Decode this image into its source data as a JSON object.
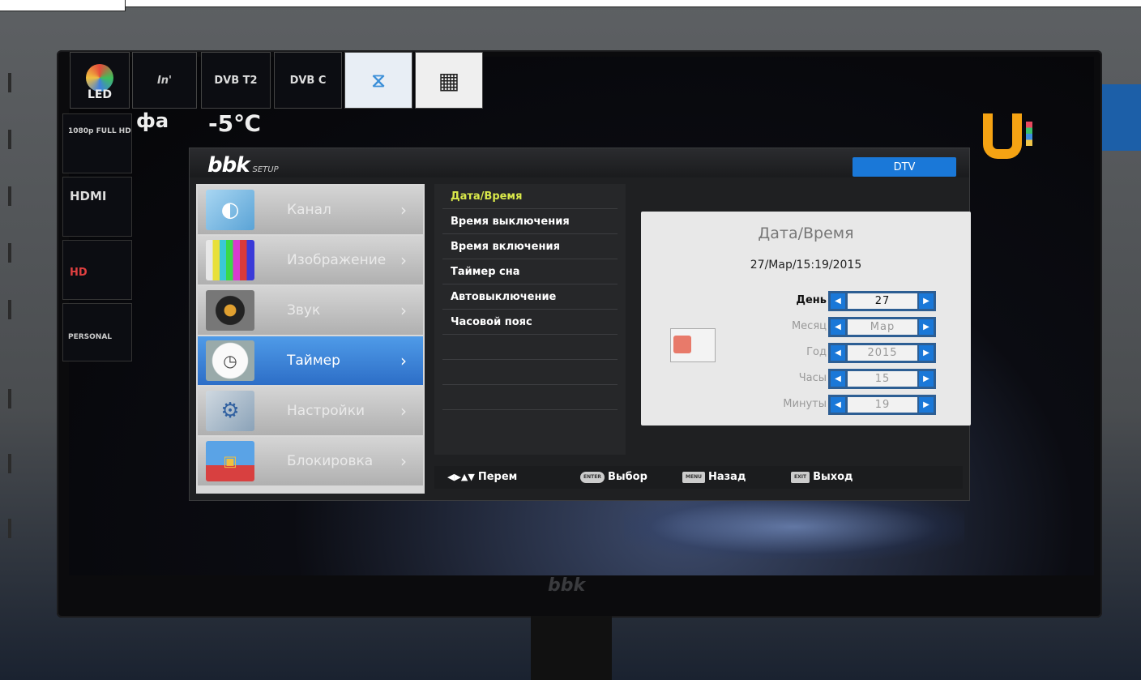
{
  "badges": {
    "led": "LED",
    "infoboard": "In'",
    "dvb_t2": "DVB T2",
    "dvb_c": "DVB C",
    "full_hd": "1080p FULL HD",
    "hdmi": "HDMI",
    "hd_media": "HD",
    "personal": "PERSONAL"
  },
  "tv_brand": "bbk",
  "weather_text": "фа",
  "temperature": "-5℃",
  "osd": {
    "logo": "bbk",
    "logo_suffix": "SETUP",
    "source_badge": "DTV",
    "menu": [
      {
        "label": "Канал",
        "icon": "satellite-dish-icon",
        "active": false
      },
      {
        "label": "Изображение",
        "icon": "tv-test-pattern-icon",
        "active": false
      },
      {
        "label": "Звук",
        "icon": "speaker-icon",
        "active": false
      },
      {
        "label": "Таймер",
        "icon": "clock-icon",
        "active": true
      },
      {
        "label": "Настройки",
        "icon": "gear-icon",
        "active": false
      },
      {
        "label": "Блокировка",
        "icon": "lock-icon",
        "active": false
      }
    ],
    "submenu": [
      {
        "label": "Дата/Время",
        "active": true
      },
      {
        "label": "Время выключения",
        "active": false
      },
      {
        "label": "Время включения",
        "active": false
      },
      {
        "label": "Таймер сна",
        "active": false
      },
      {
        "label": "Автовыключение",
        "active": false
      },
      {
        "label": "Часовой пояс",
        "active": false
      }
    ],
    "panel": {
      "title": "Дата/Время",
      "datetime": "27/Мар/15:19/2015",
      "fields": [
        {
          "label": "День",
          "value": "27",
          "active": true
        },
        {
          "label": "Месяц",
          "value": "Мар",
          "active": false
        },
        {
          "label": "Год",
          "value": "2015",
          "active": false
        },
        {
          "label": "Часы",
          "value": "15",
          "active": false
        },
        {
          "label": "Минуты",
          "value": "19",
          "active": false
        }
      ]
    },
    "footer": {
      "move_label": "Перем",
      "select_key": "ENTER",
      "select_label": "Выбор",
      "back_key": "MENU",
      "back_label": "Назад",
      "exit_key": "EXIT",
      "exit_label": "Выход"
    }
  },
  "colors": {
    "accent_blue": "#1a78d8",
    "active_submenu": "#d9e84a",
    "u_logo": "#f5a313"
  }
}
